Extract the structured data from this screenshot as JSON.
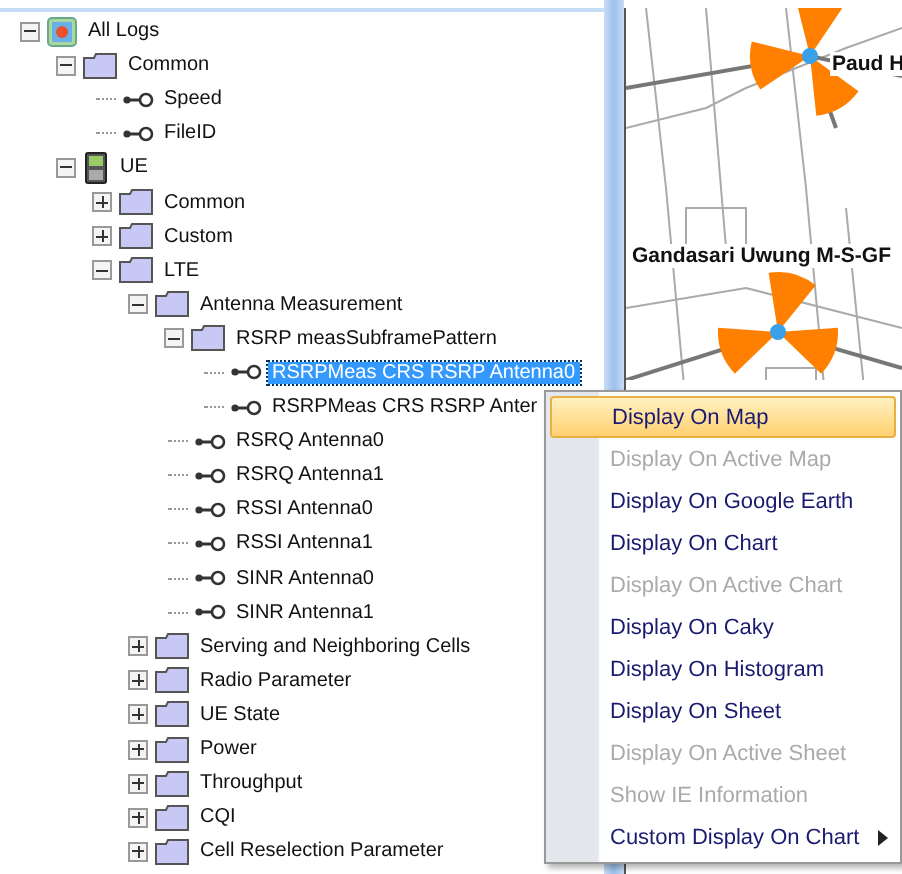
{
  "tree": [
    {
      "label": "All Logs",
      "kind": "root",
      "expanded": true,
      "children": [
        {
          "label": "Common",
          "kind": "folder",
          "expanded": true,
          "children": [
            {
              "label": "Speed",
              "kind": "leaf",
              "selected": false
            },
            {
              "label": "FileID",
              "kind": "leaf",
              "selected": false
            }
          ]
        },
        {
          "label": "UE",
          "kind": "device",
          "expanded": true,
          "children": [
            {
              "label": "Common",
              "kind": "folder",
              "expanded": false
            },
            {
              "label": "Custom",
              "kind": "folder",
              "expanded": false
            },
            {
              "label": "LTE",
              "kind": "folder",
              "expanded": true,
              "children": [
                {
                  "label": "Antenna Measurement",
                  "kind": "folder",
                  "expanded": true,
                  "children": [
                    {
                      "label": "RSRP measSubframePattern",
                      "kind": "folder",
                      "expanded": true,
                      "children": [
                        {
                          "label": "RSRPMeas CRS RSRP Antenna0",
                          "kind": "leaf",
                          "selected": true
                        },
                        {
                          "label": "RSRPMeas CRS RSRP Anter",
                          "kind": "leaf",
                          "selected": false
                        }
                      ]
                    },
                    {
                      "label": "RSRQ Antenna0",
                      "kind": "leaf",
                      "selected": false
                    },
                    {
                      "label": "RSRQ Antenna1",
                      "kind": "leaf",
                      "selected": false
                    },
                    {
                      "label": "RSSI Antenna0",
                      "kind": "leaf",
                      "selected": false
                    },
                    {
                      "label": "RSSI Antenna1",
                      "kind": "leaf",
                      "selected": false
                    },
                    {
                      "label": "SINR Antenna0",
                      "kind": "leaf",
                      "selected": false
                    },
                    {
                      "label": "SINR Antenna1",
                      "kind": "leaf",
                      "selected": false
                    }
                  ]
                },
                {
                  "label": "Serving and Neighboring Cells",
                  "kind": "folder",
                  "expanded": false
                },
                {
                  "label": "Radio Parameter",
                  "kind": "folder",
                  "expanded": false
                },
                {
                  "label": "UE State",
                  "kind": "folder",
                  "expanded": false
                },
                {
                  "label": "Power",
                  "kind": "folder",
                  "expanded": false
                },
                {
                  "label": "Throughput",
                  "kind": "folder",
                  "expanded": false
                },
                {
                  "label": "CQI",
                  "kind": "folder",
                  "expanded": false
                },
                {
                  "label": "Cell Reselection Parameter",
                  "kind": "folder",
                  "expanded": false
                }
              ]
            }
          ]
        }
      ]
    }
  ],
  "map": {
    "labels": [
      "Paud H",
      "Gandasari Uwung M-S-GF"
    ]
  },
  "context_menu": [
    {
      "label": "Display On Map",
      "disabled": false,
      "selected": true,
      "submenu": false
    },
    {
      "label": "Display On Active Map",
      "disabled": true,
      "selected": false,
      "submenu": false
    },
    {
      "label": "Display On Google Earth",
      "disabled": false,
      "selected": false,
      "submenu": false
    },
    {
      "label": "Display On Chart",
      "disabled": false,
      "selected": false,
      "submenu": false
    },
    {
      "label": "Display On Active Chart",
      "disabled": true,
      "selected": false,
      "submenu": false
    },
    {
      "label": "Display On Caky",
      "disabled": false,
      "selected": false,
      "submenu": false
    },
    {
      "label": "Display On Histogram",
      "disabled": false,
      "selected": false,
      "submenu": false
    },
    {
      "label": "Display On Sheet",
      "disabled": false,
      "selected": false,
      "submenu": false
    },
    {
      "label": "Display On Active Sheet",
      "disabled": true,
      "selected": false,
      "submenu": false
    },
    {
      "label": "Show IE Information",
      "disabled": true,
      "selected": false,
      "submenu": false
    },
    {
      "label": "Custom Display On Chart",
      "disabled": false,
      "selected": false,
      "submenu": true
    }
  ]
}
